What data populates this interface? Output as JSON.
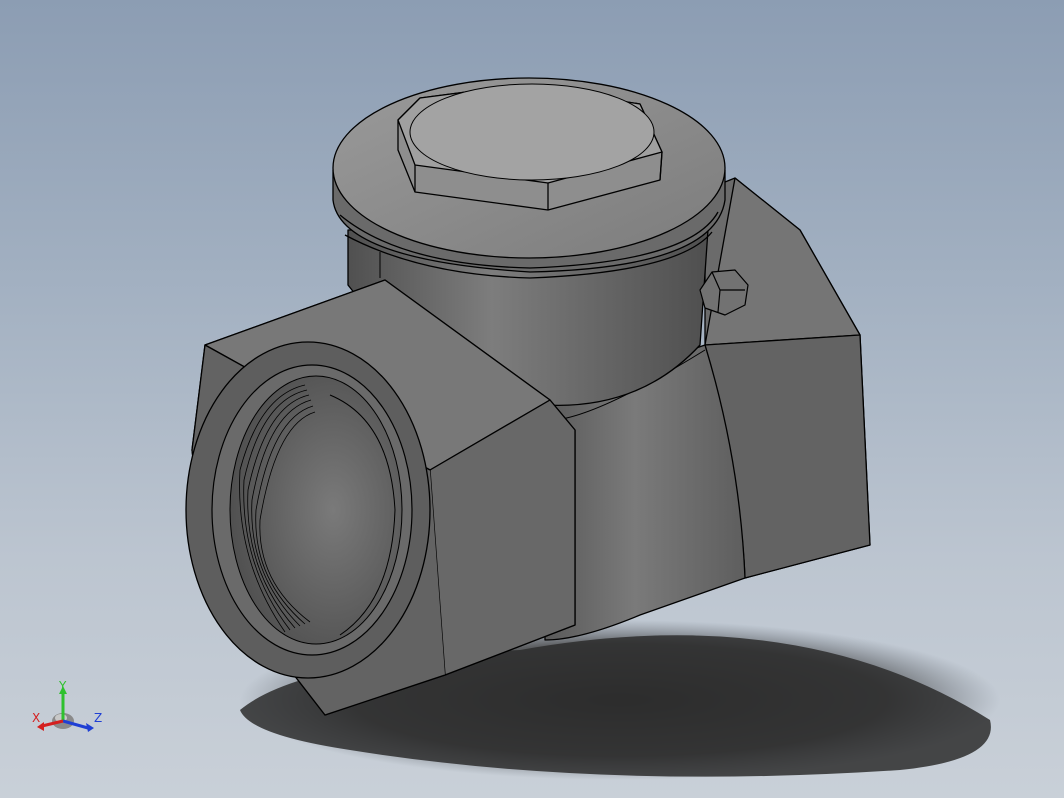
{
  "viewport": {
    "background_top": "#8c9db3",
    "background_bottom": "#c9d0d8"
  },
  "model": {
    "body_color": "#6f6f6f",
    "edge_color": "#000000",
    "shadow_color": "#2b2b2b"
  },
  "triad": {
    "x_label": "X",
    "y_label": "Y",
    "z_label": "Z",
    "x_color": "#d41f1f",
    "y_color": "#2ec12e",
    "z_color": "#1f3fd4"
  }
}
